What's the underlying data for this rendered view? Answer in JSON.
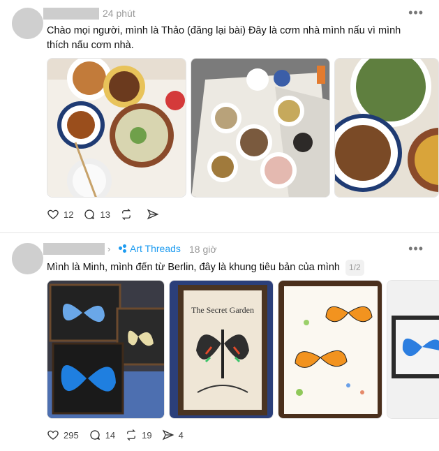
{
  "posts": [
    {
      "time": "24 phút",
      "text": "Chào mọi người, mình là Thảo (đăng lại bài) Đây là cơm nhà mình nấu vì mình thích nấu cơm nhà.",
      "likes": "12",
      "comments": "13",
      "reposts": "",
      "shares": "",
      "images": [
        "food-photo-1",
        "food-photo-2",
        "food-photo-3"
      ]
    },
    {
      "community": "Art Threads",
      "time": "18 giờ",
      "text": "Mình là Minh, mình đến từ Berlin, đây là khung tiêu bản của mình",
      "counter": "1/2",
      "likes": "295",
      "comments": "14",
      "reposts": "19",
      "shares": "4",
      "images": [
        "butterfly-frames-photo",
        "secret-garden-frame-photo",
        "butterfly-specimen-frame-photo",
        "blue-butterfly-frame-photo"
      ],
      "book_title": "The Secret Garden"
    }
  ],
  "icons": {
    "more": "more-horizontal-icon",
    "like": "heart-icon",
    "comment": "comment-icon",
    "repost": "repost-icon",
    "share": "share-icon",
    "chevron": "chevron-right-icon",
    "community": "community-icon"
  },
  "colors": {
    "accent": "#1d9bf0",
    "muted": "#999999",
    "divider": "#e5e5e5"
  }
}
